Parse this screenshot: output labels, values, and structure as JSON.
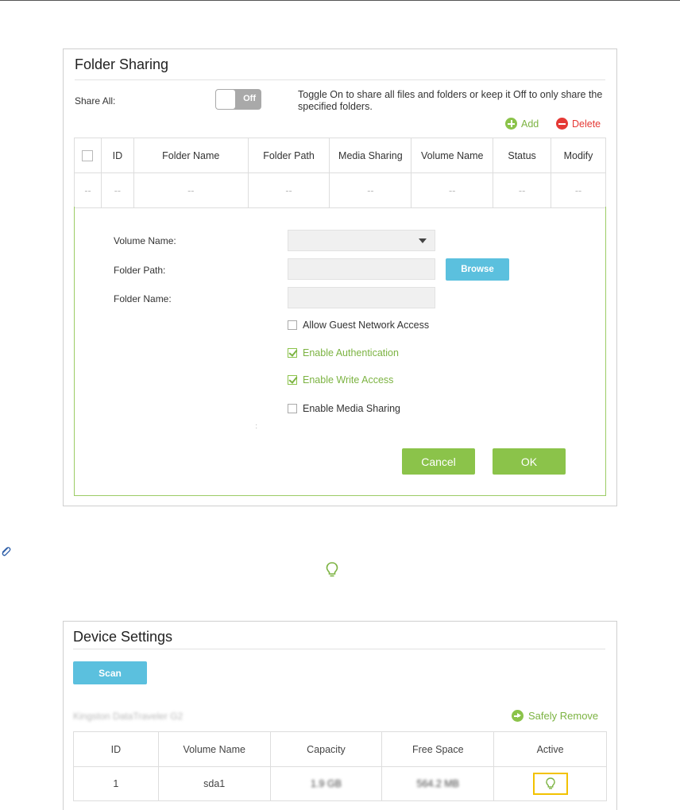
{
  "folder_sharing": {
    "title": "Folder Sharing",
    "share_all_label": "Share All:",
    "toggle_state": "Off",
    "toggle_description": "Toggle On to share all files and folders or keep it Off to only share the specified folders.",
    "add_label": "Add",
    "delete_label": "Delete",
    "table": {
      "headers": [
        "ID",
        "Folder Name",
        "Folder Path",
        "Media Sharing",
        "Volume Name",
        "Status",
        "Modify"
      ],
      "row": [
        "--",
        "--",
        "--",
        "--",
        "--",
        "--",
        "--",
        "--"
      ]
    },
    "form": {
      "volume_name_label": "Volume Name:",
      "folder_path_label": "Folder Path:",
      "folder_name_label": "Folder Name:",
      "browse_label": "Browse",
      "checkboxes": [
        {
          "label": "Allow Guest Network Access",
          "checked": false
        },
        {
          "label": "Enable Authentication",
          "checked": true
        },
        {
          "label": "Enable Write Access",
          "checked": true
        },
        {
          "label": "Enable Media Sharing",
          "checked": false
        }
      ],
      "cancel_label": "Cancel",
      "ok_label": "OK"
    }
  },
  "device_settings": {
    "title": "Device Settings",
    "scan_label": "Scan",
    "device_name": "Kingston DataTraveler G2",
    "safely_remove_label": "Safely Remove",
    "table": {
      "headers": [
        "ID",
        "Volume Name",
        "Capacity",
        "Free Space",
        "Active"
      ],
      "rows": [
        {
          "id": "1",
          "volume_name": "sda1",
          "capacity": "1.9 GB",
          "free_space": "564.2 MB"
        }
      ]
    }
  },
  "colors": {
    "accent_green": "#8bc34a",
    "accent_blue": "#5bc0de",
    "delete_red": "#e53935",
    "highlight_yellow": "#f2c200"
  },
  "icons": [
    "paperclip-icon",
    "lightbulb-icon",
    "plus-circle-icon",
    "minus-circle-icon",
    "arrow-circle-icon",
    "dropdown-caret-icon"
  ]
}
